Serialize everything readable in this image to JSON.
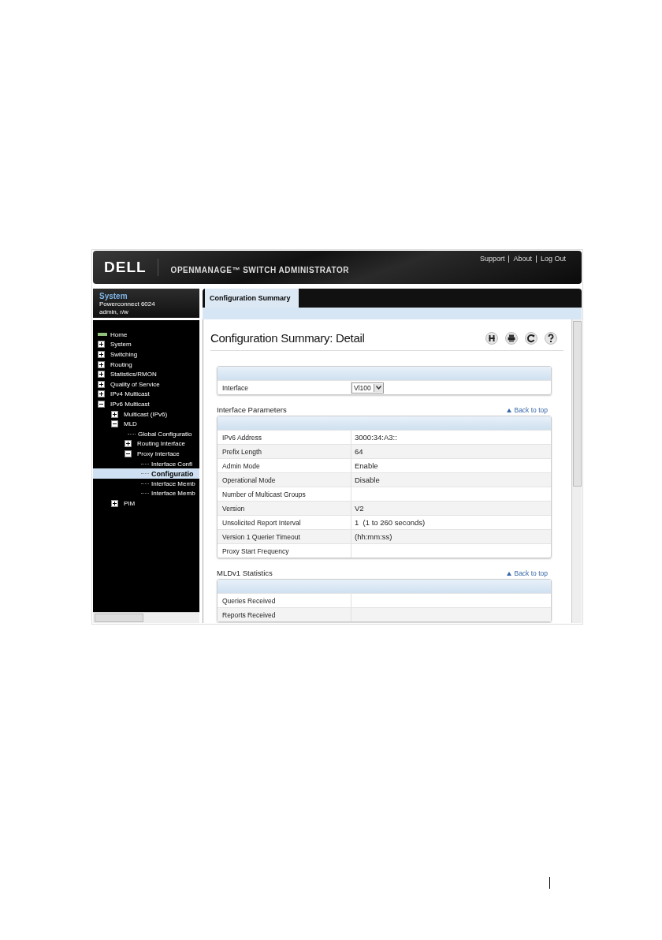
{
  "header": {
    "logo": "DELL",
    "title": "OPENMANAGE™ SWITCH ADMINISTRATOR",
    "links": [
      "Support",
      "About",
      "Log Out"
    ]
  },
  "system": {
    "title": "System",
    "device": "Powerconnect 6024",
    "user": "admin, r/w"
  },
  "tree": [
    {
      "label": "Home",
      "kind": "home",
      "selected": false
    },
    {
      "label": "System",
      "kind": "folder",
      "expanded": false,
      "selected": false
    },
    {
      "label": "Switching",
      "kind": "folder",
      "expanded": false,
      "selected": false
    },
    {
      "label": "Routing",
      "kind": "folder",
      "expanded": false,
      "selected": false
    },
    {
      "label": "Statistics/RMON",
      "kind": "folder",
      "expanded": false,
      "selected": false
    },
    {
      "label": "Quality of Service",
      "kind": "folder",
      "expanded": false,
      "selected": false
    },
    {
      "label": "IPv4 Multicast",
      "kind": "folder",
      "expanded": false,
      "selected": false
    },
    {
      "label": "IPv6 Multicast",
      "kind": "folder",
      "expanded": true,
      "selected": false,
      "children": [
        {
          "label": "Multicast (IPv6)",
          "kind": "folder",
          "expanded": false,
          "selected": false
        },
        {
          "label": "MLD",
          "kind": "folder",
          "expanded": true,
          "selected": false,
          "children": [
            {
              "label": "Global Configuratio",
              "kind": "leaf",
              "selected": false
            },
            {
              "label": "Routing Interface",
              "kind": "folder",
              "expanded": false,
              "selected": false
            },
            {
              "label": "Proxy Interface",
              "kind": "folder",
              "expanded": true,
              "selected": false,
              "children": [
                {
                  "label": "Interface Confi",
                  "kind": "leaf",
                  "selected": false
                },
                {
                  "label": "Configuratio",
                  "kind": "leaf",
                  "selected": true
                },
                {
                  "label": "Interface Memb",
                  "kind": "leaf",
                  "selected": false
                },
                {
                  "label": "Interface Memb",
                  "kind": "leaf",
                  "selected": false
                }
              ]
            }
          ]
        },
        {
          "label": "PIM",
          "kind": "folder",
          "expanded": false,
          "selected": false
        }
      ]
    }
  ],
  "tabs": [
    {
      "label": "Configuration Summary",
      "selected": true
    }
  ],
  "page": {
    "title": "Configuration Summary: Detail"
  },
  "interface_table": {
    "rows": [
      {
        "label": "Interface",
        "value": "Vl100",
        "kind": "select"
      }
    ]
  },
  "sections": [
    {
      "title": "Interface Parameters",
      "link": "Back to top",
      "rows": [
        {
          "label": "IPv6 Address",
          "value": "3000:34:A3::"
        },
        {
          "label": "Prefix Length",
          "value": "64"
        },
        {
          "label": "Admin Mode",
          "value": "Enable"
        },
        {
          "label": "Operational Mode",
          "value": "Disable"
        },
        {
          "label": "Number of Multicast Groups"
        },
        {
          "label": "Version",
          "value": "V2"
        },
        {
          "label": "Unsolicited Report Interval",
          "value": "1  (1 to 260 seconds)"
        },
        {
          "label": "Version 1 Querier Timeout",
          "value": "(hh:mm:ss)"
        },
        {
          "label": "Proxy Start Frequency"
        }
      ]
    },
    {
      "title": "MLDv1 Statistics",
      "link": "Back to top",
      "rows": [
        {
          "label": "Queries Received"
        },
        {
          "label": "Reports Received"
        }
      ]
    }
  ]
}
